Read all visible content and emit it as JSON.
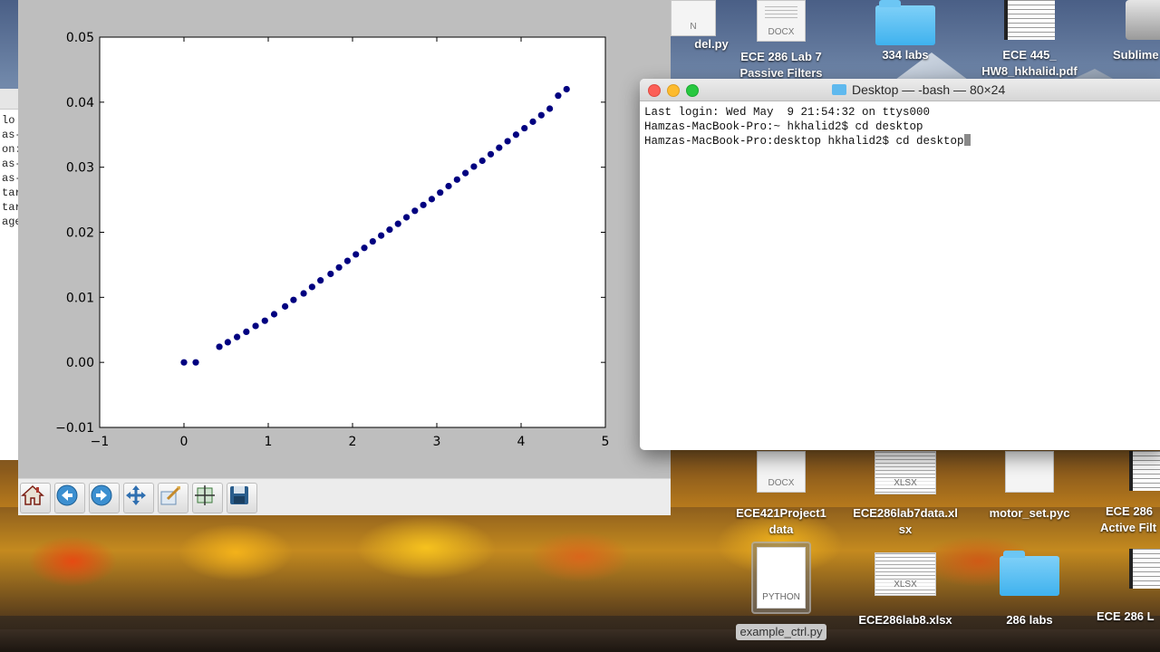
{
  "plot": {
    "chart_data": {
      "type": "scatter",
      "x": [
        0.0,
        0.14,
        0.42,
        0.52,
        0.63,
        0.74,
        0.85,
        0.96,
        1.07,
        1.2,
        1.3,
        1.42,
        1.52,
        1.62,
        1.74,
        1.84,
        1.94,
        2.04,
        2.14,
        2.24,
        2.34,
        2.44,
        2.54,
        2.64,
        2.74,
        2.84,
        2.94,
        3.04,
        3.14,
        3.24,
        3.34,
        3.44,
        3.54,
        3.64,
        3.74,
        3.84,
        3.94,
        4.04,
        4.14,
        4.24,
        4.34,
        4.44,
        4.54
      ],
      "y": [
        0.0,
        0.0,
        0.0024,
        0.0031,
        0.0039,
        0.0047,
        0.0056,
        0.0064,
        0.0074,
        0.0086,
        0.0096,
        0.0106,
        0.0116,
        0.0126,
        0.0136,
        0.0146,
        0.0156,
        0.0166,
        0.0176,
        0.0186,
        0.0195,
        0.0204,
        0.0213,
        0.0223,
        0.0233,
        0.0242,
        0.0251,
        0.0261,
        0.0271,
        0.0281,
        0.0291,
        0.0301,
        0.031,
        0.032,
        0.033,
        0.034,
        0.035,
        0.036,
        0.037,
        0.038,
        0.039,
        0.041,
        0.042
      ],
      "xlim": [
        -1,
        5
      ],
      "ylim": [
        -0.01,
        0.05
      ],
      "xticks": [
        "−1",
        "0",
        "1",
        "2",
        "3",
        "4",
        "5"
      ],
      "yticks": [
        "0.05",
        "0.04",
        "0.03",
        "0.02",
        "0.01",
        "0.00",
        "−0.01"
      ],
      "marker_color": "#000080",
      "grid": false,
      "title": "",
      "xlabel": "",
      "ylabel": ""
    },
    "toolbar": [
      {
        "name": "home-icon"
      },
      {
        "name": "back-icon"
      },
      {
        "name": "forward-icon"
      },
      {
        "name": "pan-icon"
      },
      {
        "name": "zoom-icon"
      },
      {
        "name": "subplots-icon"
      },
      {
        "name": "save-icon"
      }
    ]
  },
  "left_window": {
    "lines": [
      "lo",
      "as-",
      "on:",
      "as-",
      "as-",
      "tar",
      "tar",
      "age"
    ]
  },
  "terminal": {
    "title": "Desktop — -bash — 80×24",
    "lines": [
      "Last login: Wed May  9 21:54:32 on ttys000",
      "Hamzas-MacBook-Pro:~ hkhalid2$ cd desktop",
      "Hamzas-MacBook-Pro:desktop hkhalid2$ cd desktop"
    ]
  },
  "desktop_icons": [
    {
      "id": "d1",
      "label1": "del.py",
      "label2": "",
      "kind": "doc",
      "tag": "N"
    },
    {
      "id": "d2",
      "label1": "ECE 286 Lab 7",
      "label2": "Passive Filters",
      "kind": "doc",
      "tag": "DOCX"
    },
    {
      "id": "d3",
      "label1": "334 labs",
      "label2": "",
      "kind": "folder",
      "tag": ""
    },
    {
      "id": "d4",
      "label1": "ECE 445_",
      "label2": "HW8_hkhalid.pdf",
      "kind": "pdf",
      "tag": ""
    },
    {
      "id": "d5",
      "label1": "Sublime",
      "label2": "",
      "kind": "drive",
      "tag": ""
    },
    {
      "id": "d6",
      "label1": "ECE421Project1",
      "label2": "data",
      "kind": "doc",
      "tag": "DOCX"
    },
    {
      "id": "d7",
      "label1": "ECE286lab7data.xl",
      "label2": "sx",
      "kind": "sheet",
      "tag": "XLSX"
    },
    {
      "id": "d8",
      "label1": "motor_set.pyc",
      "label2": "",
      "kind": "doc",
      "tag": ""
    },
    {
      "id": "d9",
      "label1": "ECE 286",
      "label2": "Active Filt",
      "kind": "pdf",
      "tag": ""
    },
    {
      "id": "d10",
      "label1": "example_ctrl.py",
      "label2": "",
      "kind": "python",
      "tag": "PYTHON"
    },
    {
      "id": "d11",
      "label1": "ECE286lab8.xlsx",
      "label2": "",
      "kind": "sheet",
      "tag": "XLSX"
    },
    {
      "id": "d12",
      "label1": "286 labs",
      "label2": "",
      "kind": "folder",
      "tag": ""
    },
    {
      "id": "d13",
      "label1": "ECE 286 L",
      "label2": "",
      "kind": "pdf",
      "tag": ""
    }
  ]
}
